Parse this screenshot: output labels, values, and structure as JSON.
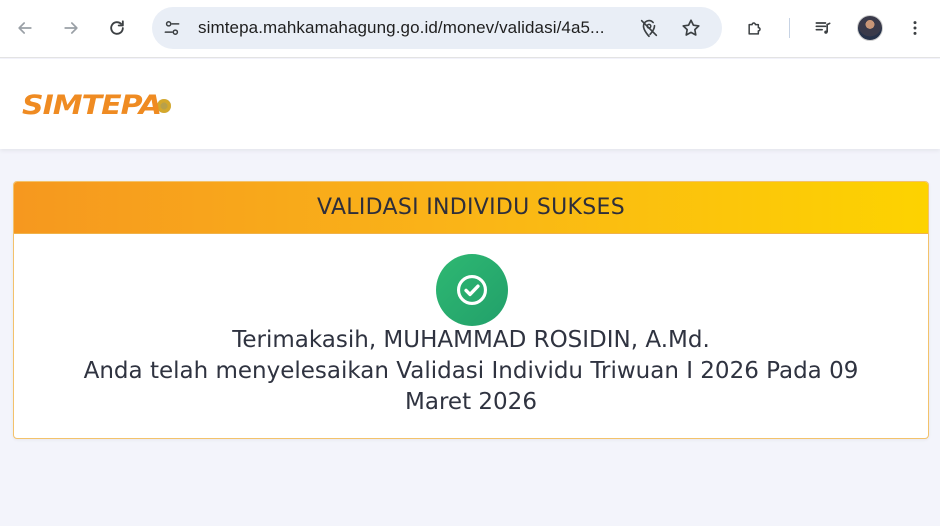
{
  "browser": {
    "url": "simtepa.mahkamahagung.go.id/monev/validasi/4a5..."
  },
  "site": {
    "logo_text": "SIMTEPA"
  },
  "card": {
    "title": "VALIDASI INDIVIDU SUKSES",
    "line1": "Terimakasih, MUHAMMAD ROSIDIN, A.Md.",
    "line2": "Anda telah menyelesaikan Validasi Individu Triwuan I 2026 Pada 09",
    "line3": "Maret 2026",
    "status_icon": "check-circle-icon"
  },
  "colors": {
    "brand_orange": "#ef8b22",
    "header_gradient_start": "#f6981f",
    "header_gradient_end": "#fdd300",
    "success_green": "#22a06a",
    "page_bg": "#f3f4fb"
  }
}
